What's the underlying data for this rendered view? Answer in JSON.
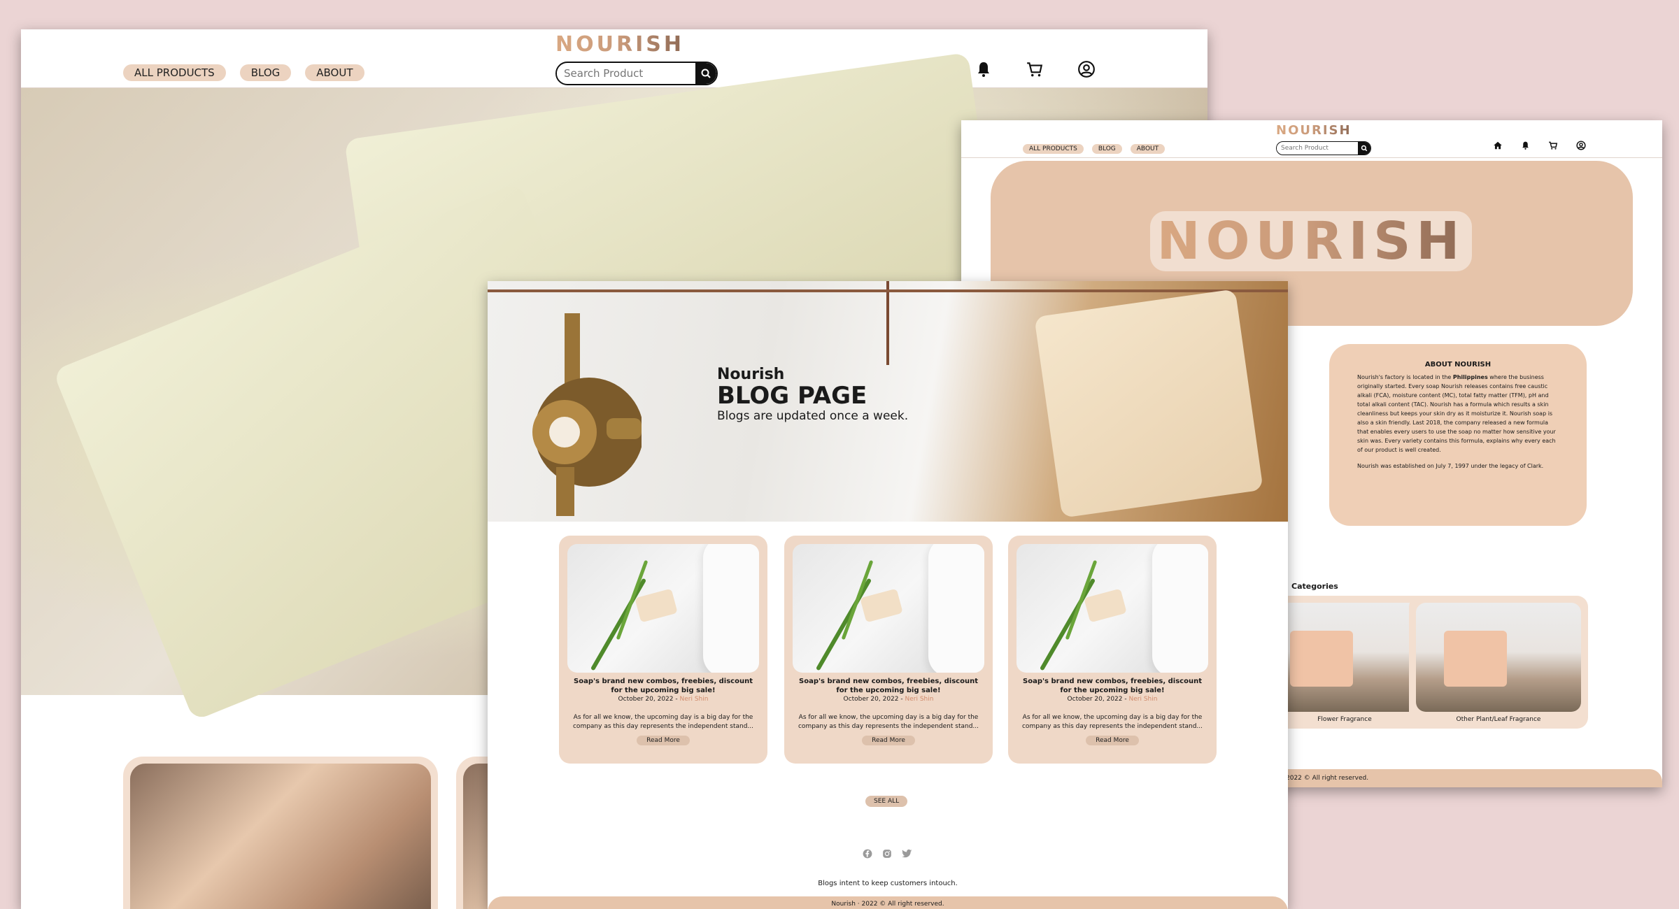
{
  "brand": "NOURISH",
  "nav": {
    "all_products": "ALL PRODUCTS",
    "blog": "BLOG",
    "about": "ABOUT"
  },
  "search": {
    "placeholder": "Search Product"
  },
  "header_icons": [
    "home-icon",
    "bell-icon",
    "cart-icon",
    "account-icon"
  ],
  "about_page": {
    "about_title": "ABOUT NOURISH",
    "about_body_1_pre": "Nourish's factory is located in the ",
    "about_body_1_bold": "Philippines",
    "about_body_1_post": " where the business originally started. Every soap Nourish releases contains free caustic alkali (FCA), moisture content (MC), total fatty matter (TFM), pH and total alkali content (TAC). Nourish has a formula which results a skin cleanliness but keeps your skin dry as it moisturize it. Nourish soap is also a skin friendly. Last 2018, the company released a new formula that enables every users to use the soap no matter how sensitive your skin was. Every variety contains this formula, explains why every each of our product is well created.",
    "about_body_2": "Nourish was established on July 7, 1997 under the legacy of Clark.",
    "categories_title": "Categories",
    "categories": [
      {
        "label": "Flower Fragrance"
      },
      {
        "label": "Other Plant/Leaf Fragrance"
      }
    ],
    "footer": "2022 © All right reserved."
  },
  "blog_page": {
    "hero_small": "Nourish",
    "hero_title": "BLOG PAGE",
    "hero_sub": "Blogs are updated once a week.",
    "posts": [
      {
        "title": "Soap's brand new combos, freebies, discount for the upcoming big sale!",
        "date": "October 20, 2022 - ",
        "author": "Neri Shin",
        "excerpt": "As for all we know, the upcoming day is a big day for the company as this day represents the independent stand...",
        "read_more": "Read More"
      },
      {
        "title": "Soap's brand new combos, freebies, discount for the upcoming big sale!",
        "date": "October 20, 2022 - ",
        "author": "Neri Shin",
        "excerpt": "As for all we know, the upcoming day is a big day for the company as this day represents the independent stand...",
        "read_more": "Read More"
      },
      {
        "title": "Soap's brand new combos, freebies, discount for the upcoming big sale!",
        "date": "October 20, 2022 - ",
        "author": "Neri Shin",
        "excerpt": "As for all we know, the upcoming day is a big day for the company as this day represents the independent stand...",
        "read_more": "Read More"
      }
    ],
    "see_all": "SEE ALL",
    "social_icons": [
      "facebook-icon",
      "instagram-icon",
      "twitter-icon"
    ],
    "tagline": "Blogs intent to keep customers intouch.",
    "footer": "Nourish · 2022 © All right reserved."
  },
  "colors": {
    "background": "#ebd4d4",
    "accent": "#e6c4aa",
    "pill": "#ecd3c0",
    "author": "#d08a6b"
  }
}
